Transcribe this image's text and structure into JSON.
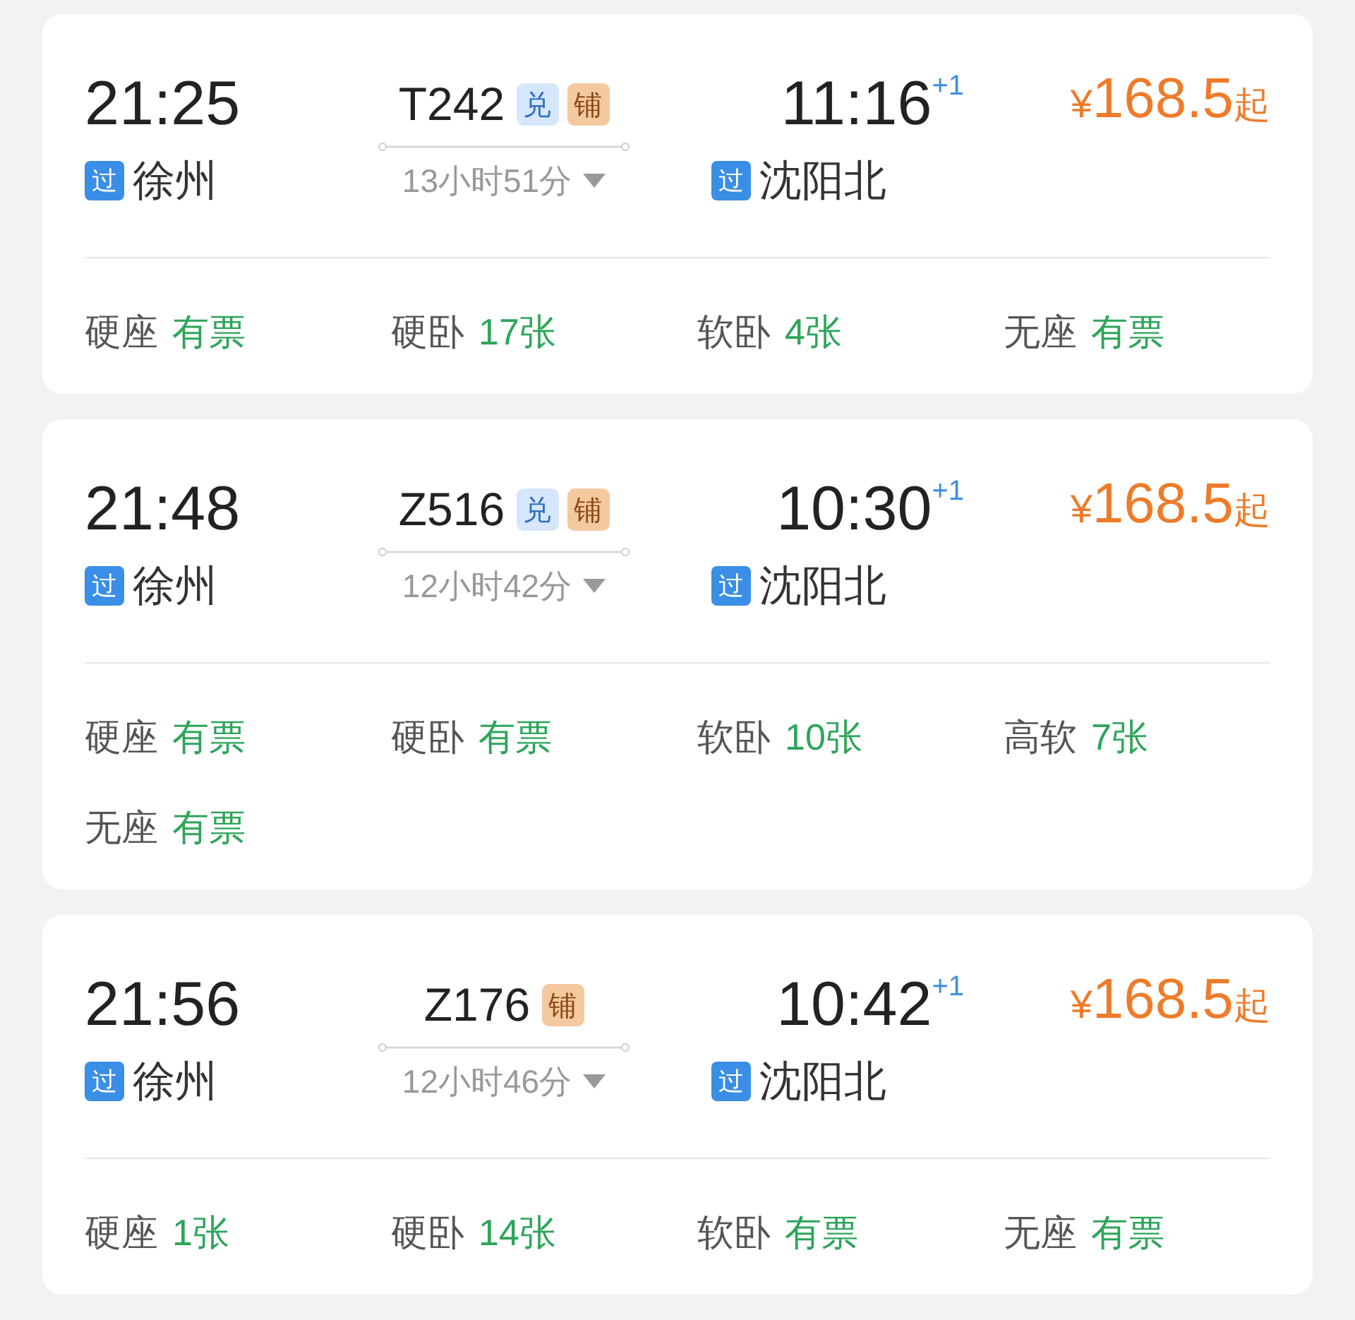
{
  "trains": [
    {
      "depart_time": "21:25",
      "depart_tag": "过",
      "depart_station": "徐州",
      "number": "T242",
      "badges": [
        {
          "kind": "exchange",
          "text": "兑"
        },
        {
          "kind": "berth",
          "text": "铺"
        }
      ],
      "duration": "13小时51分",
      "arrive_time": "11:16",
      "day_offset": "+1",
      "arrive_tag": "过",
      "arrive_station": "沈阳北",
      "currency": "¥",
      "price": "168.5",
      "price_suffix": "起",
      "seats": [
        {
          "name": "硬座",
          "availability": "有票"
        },
        {
          "name": "硬卧",
          "availability": "17张"
        },
        {
          "name": "软卧",
          "availability": "4张"
        },
        {
          "name": "无座",
          "availability": "有票"
        }
      ]
    },
    {
      "depart_time": "21:48",
      "depart_tag": "过",
      "depart_station": "徐州",
      "number": "Z516",
      "badges": [
        {
          "kind": "exchange",
          "text": "兑"
        },
        {
          "kind": "berth",
          "text": "铺"
        }
      ],
      "duration": "12小时42分",
      "arrive_time": "10:30",
      "day_offset": "+1",
      "arrive_tag": "过",
      "arrive_station": "沈阳北",
      "currency": "¥",
      "price": "168.5",
      "price_suffix": "起",
      "seats": [
        {
          "name": "硬座",
          "availability": "有票"
        },
        {
          "name": "硬卧",
          "availability": "有票"
        },
        {
          "name": "软卧",
          "availability": "10张"
        },
        {
          "name": "高软",
          "availability": "7张"
        },
        {
          "name": "无座",
          "availability": "有票"
        }
      ]
    },
    {
      "depart_time": "21:56",
      "depart_tag": "过",
      "depart_station": "徐州",
      "number": "Z176",
      "badges": [
        {
          "kind": "berth",
          "text": "铺"
        }
      ],
      "duration": "12小时46分",
      "arrive_time": "10:42",
      "day_offset": "+1",
      "arrive_tag": "过",
      "arrive_station": "沈阳北",
      "currency": "¥",
      "price": "168.5",
      "price_suffix": "起",
      "seats": [
        {
          "name": "硬座",
          "availability": "1张"
        },
        {
          "name": "硬卧",
          "availability": "14张"
        },
        {
          "name": "软卧",
          "availability": "有票"
        },
        {
          "name": "无座",
          "availability": "有票"
        }
      ]
    }
  ]
}
